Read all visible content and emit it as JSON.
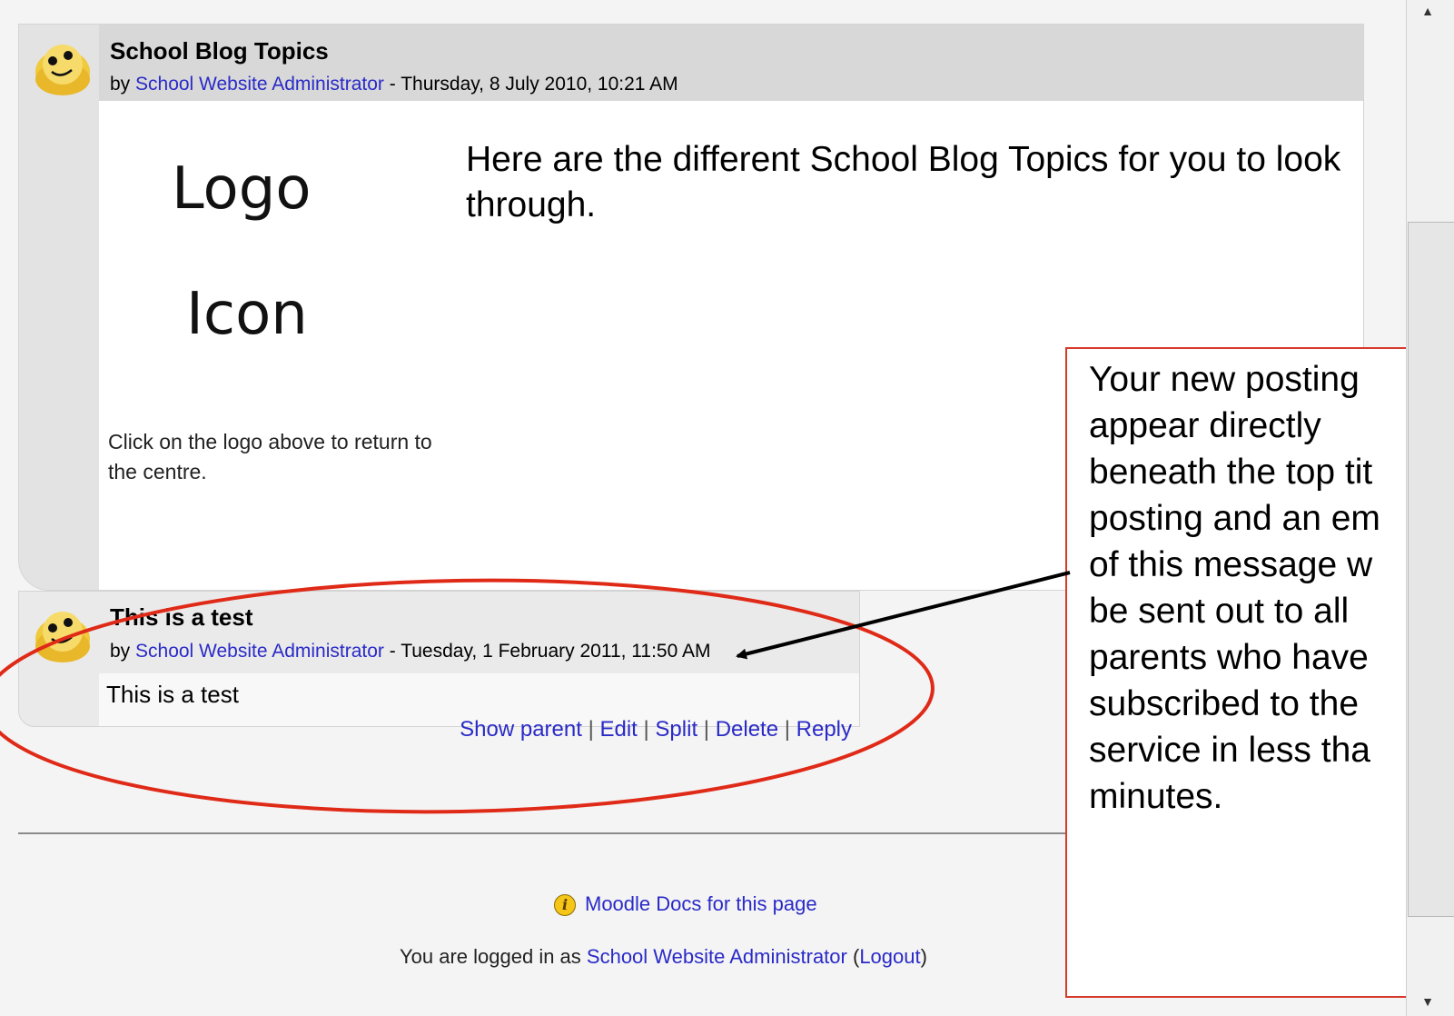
{
  "post1": {
    "title": "School Blog Topics",
    "by": "by",
    "author": "School Website Administrator",
    "date": " - Thursday, 8 July 2010, 10:21 AM",
    "logo_line1": "Logo",
    "logo_line2": "Icon",
    "caption": "Click on the logo above to return to the centre.",
    "message": "Here are the different School Blog Topics for you to look through."
  },
  "post2": {
    "title": "This is a test",
    "by": "by",
    "author": "School Website Administrator",
    "date": " - Tuesday, 1 February 2011, 11:50 AM",
    "message": "This is a test",
    "commands": {
      "show_parent": "Show parent",
      "edit": "Edit",
      "split": "Split",
      "delete": "Delete",
      "reply": "Reply",
      "separator": " | "
    }
  },
  "footer": {
    "docs_link": "Moodle Docs for this page",
    "logged_in_prefix": "You are logged in as ",
    "user": "School Website Administrator",
    "open_paren": " (",
    "logout": "Logout",
    "close_paren": ")"
  },
  "callout": {
    "lines": [
      "Your new posting",
      "appear directly",
      "beneath the top tit",
      "posting and an em",
      "of this message w",
      "be sent out to all",
      "parents who have",
      "subscribed to the",
      "service in less tha",
      "minutes."
    ]
  },
  "icons": {
    "avatar": "smiley-avatar-icon",
    "info": "info-icon"
  },
  "colors": {
    "link": "#2a2ac8",
    "annotation_red": "#e02a18",
    "callout_border": "#d63a2a"
  }
}
